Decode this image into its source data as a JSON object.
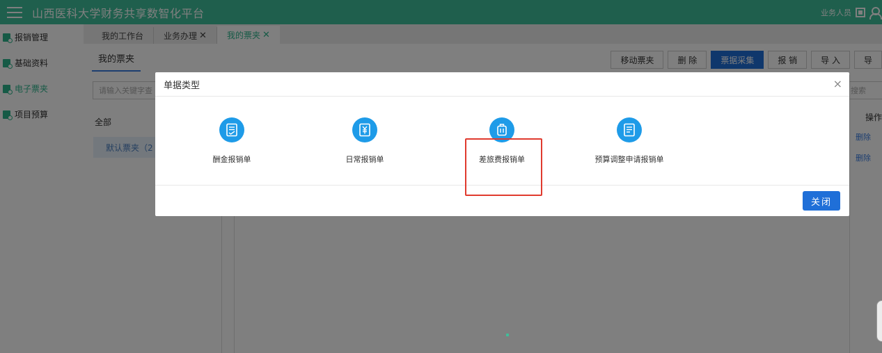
{
  "header": {
    "title": "山西医科大学财务共享数智化平台",
    "user_role": "业务人员"
  },
  "sidebar": {
    "items": [
      {
        "label": "报销管理",
        "active": false
      },
      {
        "label": "基础资料",
        "active": false
      },
      {
        "label": "电子票夹",
        "active": true
      },
      {
        "label": "项目预算",
        "active": false
      }
    ]
  },
  "tabs": [
    {
      "label": "我的工作台",
      "closable": false,
      "active": false
    },
    {
      "label": "业务办理",
      "closable": true,
      "active": false
    },
    {
      "label": "我的票夹",
      "closable": true,
      "active": true
    }
  ],
  "tab_close_glyph": "✕",
  "page": {
    "subtab": "我的票夹",
    "toolbar": [
      "移动票夹",
      "删 除",
      "票据采集",
      "报 销",
      "导 入",
      "导"
    ],
    "search_placeholder": "请输入关键字查",
    "right_search_placeholder": "搜索",
    "tree_all": "全部",
    "tree_default": "默认票夹（2",
    "col_op": "操作",
    "row_ops": [
      "删除",
      "删除"
    ]
  },
  "modal": {
    "title": "单据类型",
    "close_glyph": "×",
    "types": [
      {
        "label": "酬金报销单",
        "icon": "document-icon"
      },
      {
        "label": "日常报销单",
        "icon": "money-document-icon"
      },
      {
        "label": "差旅费报销单",
        "icon": "luggage-icon"
      },
      {
        "label": "预算调整申请报销单",
        "icon": "document-icon"
      }
    ],
    "highlighted_index": 2,
    "close_button": "关闭"
  },
  "colors": {
    "header_bg": "#3fbf9a",
    "primary": "#1f6fd8",
    "icon_blue": "#1e9be8",
    "highlight": "#e03a2e"
  }
}
